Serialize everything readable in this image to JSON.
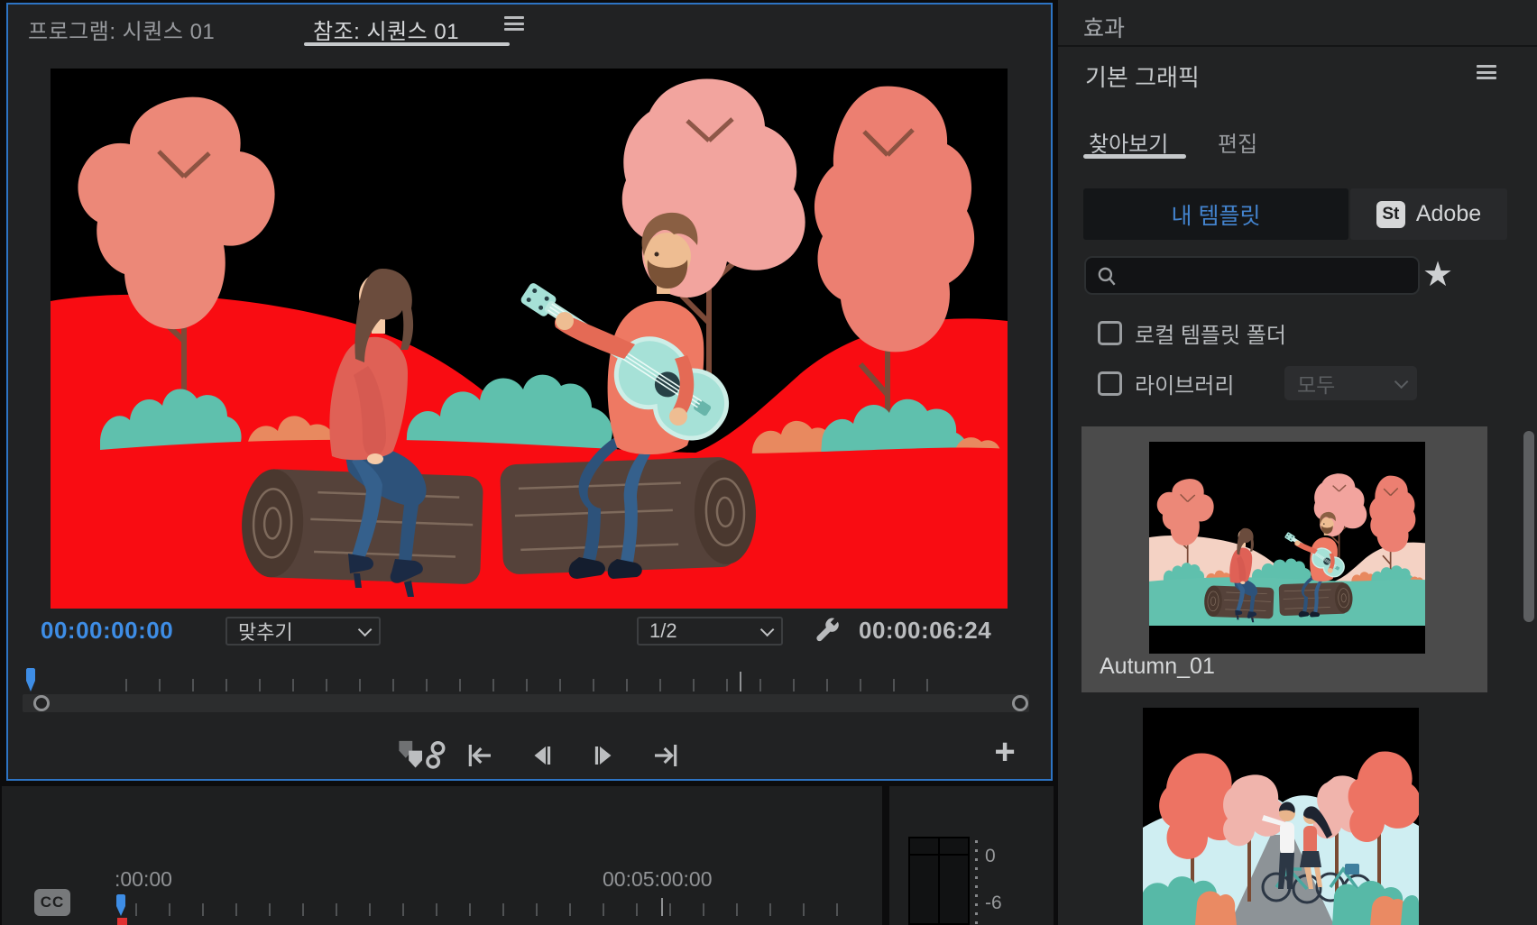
{
  "monitor": {
    "tabs": [
      {
        "label": "프로그램: 시퀀스 01",
        "active": false
      },
      {
        "label": "참조: 시퀀스 01",
        "active": true
      }
    ],
    "timecode": "00:00:00:00",
    "fit_dropdown": "맞추기",
    "playback_resolution": "1/2",
    "duration": "00:00:06:24"
  },
  "effects_panel": {
    "title": "효과"
  },
  "essential_graphics": {
    "title": "기본 그래픽",
    "tabs": [
      {
        "label": "찾아보기",
        "active": true
      },
      {
        "label": "편집",
        "active": false
      }
    ],
    "my_templates_label": "내 템플릿",
    "stock_badge": "St",
    "stock_label": "Adobe",
    "search_placeholder": "",
    "filters": [
      {
        "label": "로컬 템플릿 폴더",
        "checked": false
      },
      {
        "label": "라이브러리",
        "checked": false
      }
    ],
    "library_dropdown_value": "모두",
    "templates": [
      {
        "name": "Autumn_01",
        "selected": true
      },
      {
        "name": "",
        "selected": false
      }
    ]
  },
  "timeline_panel": {
    "cc_label": "CC",
    "ruler_labels": [
      ":00:00",
      "00:05:00:00"
    ]
  },
  "audio_meter": {
    "labels": [
      "0",
      "-6"
    ]
  },
  "theme": {
    "focus_blue": "#2d74c4",
    "timecode_blue": "#3e8de5",
    "link_blue": "#4383cd",
    "scene_red": "#f90c12",
    "thumb_hill_pink": "#f4d2c4",
    "thumb_ground_mint": "#62c1ae",
    "panel_bg": "#222324",
    "selected_card_bg": "#4b4b4b"
  }
}
